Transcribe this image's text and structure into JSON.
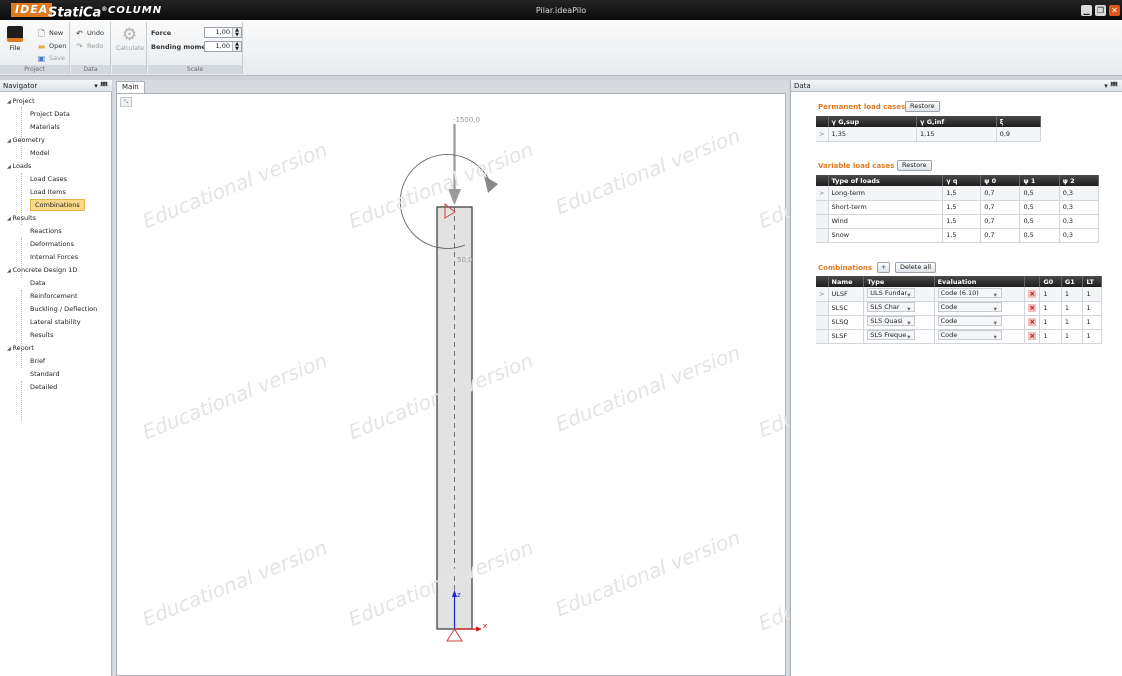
{
  "app": {
    "logo": "IDEA",
    "brand": "StatiCa",
    "trademark": "®",
    "module": "COLUMN",
    "window_title": "Pilar.ideaPilo"
  },
  "window_buttons": [
    "▁",
    "❐",
    "✕"
  ],
  "ribbon": {
    "file_label": "File",
    "project": {
      "new": "New",
      "open": "Open",
      "save": "Save",
      "label": "Project"
    },
    "data": {
      "undo": "Undo",
      "redo": "Redo",
      "label": "Data"
    },
    "calculate": "Calculate",
    "scale": {
      "force_label": "Force",
      "force_value": "1,00",
      "moment_label": "Bending moment",
      "moment_value": "1,00",
      "label": "Scale"
    }
  },
  "navigator": {
    "title": "Navigator",
    "pin": "▾ ᚙ",
    "items": [
      {
        "label": "Project",
        "level": 0
      },
      {
        "label": "Project Data",
        "level": 1
      },
      {
        "label": "Materials",
        "level": 1
      },
      {
        "label": "Geometry",
        "level": 0
      },
      {
        "label": "Model",
        "level": 1
      },
      {
        "label": "Loads",
        "level": 0
      },
      {
        "label": "Load Cases",
        "level": 1
      },
      {
        "label": "Load Items",
        "level": 1
      },
      {
        "label": "Combinations",
        "level": 1,
        "selected": true
      },
      {
        "label": "Results",
        "level": 0
      },
      {
        "label": "Reactions",
        "level": 1
      },
      {
        "label": "Deformations",
        "level": 1
      },
      {
        "label": "Internal Forces",
        "level": 1
      },
      {
        "label": "Concrete Design 1D",
        "level": 0
      },
      {
        "label": "Data",
        "level": 1
      },
      {
        "label": "Reinforcement",
        "level": 1
      },
      {
        "label": "Buckling / Deflection",
        "level": 1
      },
      {
        "label": "Lateral stability",
        "level": 1
      },
      {
        "label": "Results",
        "level": 1
      },
      {
        "label": "Report",
        "level": 0
      },
      {
        "label": "Brief",
        "level": 1
      },
      {
        "label": "Standard",
        "level": 1
      },
      {
        "label": "Detailed",
        "level": 1
      }
    ]
  },
  "main": {
    "tab": "Main",
    "watermark": "Educational version",
    "force_label": "-1500,0",
    "moment_label": "50,0",
    "axis_z": "z",
    "axis_x": "x"
  },
  "data_panel": {
    "title": "Data",
    "pin": "▾ ᚙ",
    "permanent": {
      "title": "Permanent load cases",
      "restore": "Restore",
      "headers": [
        "γ G,sup",
        "γ G,inf",
        "ξ"
      ],
      "rows": [
        [
          "1,35",
          "1,15",
          "0,9"
        ]
      ]
    },
    "variable": {
      "title": "Variable load cases",
      "restore": "Restore",
      "headers": [
        "Type of loads",
        "γ q",
        "ψ 0",
        "ψ 1",
        "ψ 2"
      ],
      "rows": [
        [
          "Long-term",
          "1,5",
          "0,7",
          "0,5",
          "0,3"
        ],
        [
          "Short-term",
          "1,5",
          "0,7",
          "0,5",
          "0,3"
        ],
        [
          "Wind",
          "1,5",
          "0,7",
          "0,5",
          "0,3"
        ],
        [
          "Snow",
          "1,5",
          "0,7",
          "0,5",
          "0,3"
        ]
      ]
    },
    "combinations": {
      "title": "Combinations",
      "add": "+",
      "delete_all": "Delete all",
      "headers": [
        "Name",
        "Type",
        "Evaluation",
        "",
        "G0",
        "G1",
        "LT"
      ],
      "rows": [
        [
          "ULSF",
          "ULS Fundar",
          "Code (6.10)",
          "1",
          "1",
          "1"
        ],
        [
          "SLSC",
          "SLS Char",
          "Code",
          "1",
          "1",
          "1"
        ],
        [
          "SLSQ",
          "SLS Quasi",
          "Code",
          "1",
          "1",
          "1"
        ],
        [
          "SLSF",
          "SLS Freque",
          "Code",
          "1",
          "1",
          "1"
        ]
      ]
    }
  },
  "colors": {
    "accent": "#e07a1f",
    "selection": "#f9d88a",
    "column_fill": "#e2e2e2"
  }
}
